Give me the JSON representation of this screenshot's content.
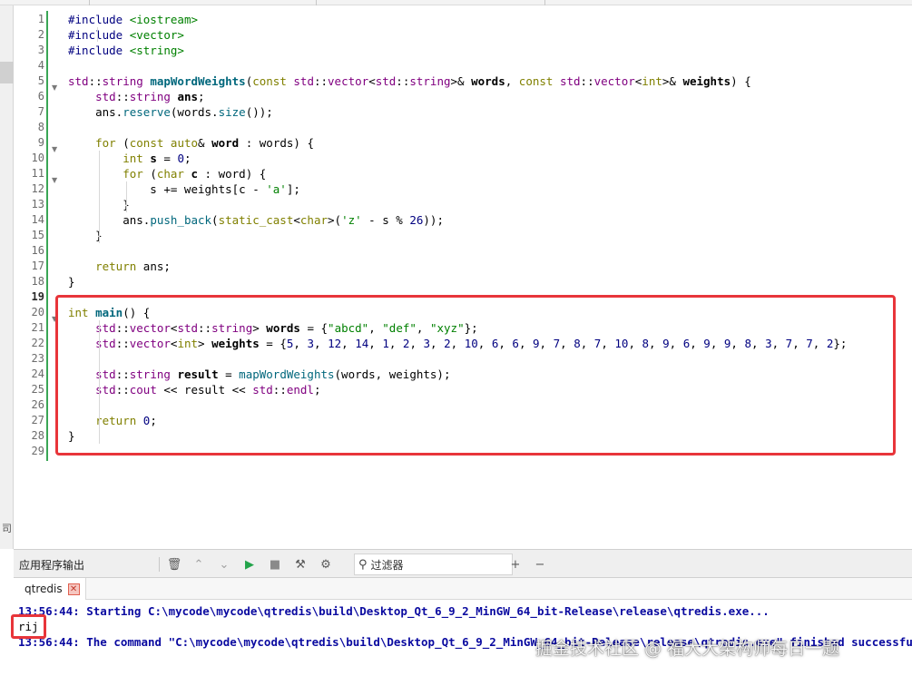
{
  "editor": {
    "line_numbers": [
      "1",
      "2",
      "3",
      "4",
      "5",
      "6",
      "7",
      "8",
      "9",
      "10",
      "11",
      "12",
      "13",
      "14",
      "15",
      "16",
      "17",
      "18",
      "19",
      "20",
      "21",
      "22",
      "23",
      "24",
      "25",
      "26",
      "27",
      "28",
      "29"
    ],
    "current_line": "19",
    "lines": [
      [
        {
          "t": "#include ",
          "c": "pp"
        },
        {
          "t": "<iostream>",
          "c": "inc"
        }
      ],
      [
        {
          "t": "#include ",
          "c": "pp"
        },
        {
          "t": "<vector>",
          "c": "inc"
        }
      ],
      [
        {
          "t": "#include ",
          "c": "pp"
        },
        {
          "t": "<string>",
          "c": "inc"
        }
      ],
      [],
      [
        {
          "t": "std",
          "c": "ty"
        },
        {
          "t": "::"
        },
        {
          "t": "string",
          "c": "ty"
        },
        {
          "t": " "
        },
        {
          "t": "mapWordWeights",
          "c": "fn bold"
        },
        {
          "t": "("
        },
        {
          "t": "const",
          "c": "kw"
        },
        {
          "t": " "
        },
        {
          "t": "std",
          "c": "ty"
        },
        {
          "t": "::"
        },
        {
          "t": "vector",
          "c": "ty"
        },
        {
          "t": "<"
        },
        {
          "t": "std",
          "c": "ty"
        },
        {
          "t": "::"
        },
        {
          "t": "string",
          "c": "ty"
        },
        {
          "t": ">& "
        },
        {
          "t": "words",
          "c": "bold"
        },
        {
          "t": ", "
        },
        {
          "t": "const",
          "c": "kw"
        },
        {
          "t": " "
        },
        {
          "t": "std",
          "c": "ty"
        },
        {
          "t": "::"
        },
        {
          "t": "vector",
          "c": "ty"
        },
        {
          "t": "<"
        },
        {
          "t": "int",
          "c": "kw"
        },
        {
          "t": ">& "
        },
        {
          "t": "weights",
          "c": "bold"
        },
        {
          "t": ") {"
        }
      ],
      [
        {
          "t": "    "
        },
        {
          "t": "std",
          "c": "ty"
        },
        {
          "t": "::"
        },
        {
          "t": "string",
          "c": "ty"
        },
        {
          "t": " "
        },
        {
          "t": "ans",
          "c": "bold"
        },
        {
          "t": ";"
        }
      ],
      [
        {
          "t": "    ans."
        },
        {
          "t": "reserve",
          "c": "fn"
        },
        {
          "t": "(words."
        },
        {
          "t": "size",
          "c": "fn"
        },
        {
          "t": "());"
        }
      ],
      [],
      [
        {
          "t": "    "
        },
        {
          "t": "for",
          "c": "kw"
        },
        {
          "t": " ("
        },
        {
          "t": "const",
          "c": "kw"
        },
        {
          "t": " "
        },
        {
          "t": "auto",
          "c": "kw"
        },
        {
          "t": "& "
        },
        {
          "t": "word",
          "c": "bold"
        },
        {
          "t": " : words) {"
        }
      ],
      [
        {
          "t": "        "
        },
        {
          "t": "int",
          "c": "kw"
        },
        {
          "t": " "
        },
        {
          "t": "s",
          "c": "bold"
        },
        {
          "t": " = "
        },
        {
          "t": "0",
          "c": "nm"
        },
        {
          "t": ";"
        }
      ],
      [
        {
          "t": "        "
        },
        {
          "t": "for",
          "c": "kw"
        },
        {
          "t": " ("
        },
        {
          "t": "char",
          "c": "kw"
        },
        {
          "t": " "
        },
        {
          "t": "c",
          "c": "bold"
        },
        {
          "t": " : word) {"
        }
      ],
      [
        {
          "t": "            s += weights[c - "
        },
        {
          "t": "'a'",
          "c": "st"
        },
        {
          "t": "];"
        }
      ],
      [
        {
          "t": "        }"
        }
      ],
      [
        {
          "t": "        ans."
        },
        {
          "t": "push_back",
          "c": "fn"
        },
        {
          "t": "("
        },
        {
          "t": "static_cast",
          "c": "kw"
        },
        {
          "t": "<"
        },
        {
          "t": "char",
          "c": "kw"
        },
        {
          "t": ">("
        },
        {
          "t": "'z'",
          "c": "st"
        },
        {
          "t": " - s % "
        },
        {
          "t": "26",
          "c": "nm"
        },
        {
          "t": "));"
        }
      ],
      [
        {
          "t": "    }"
        }
      ],
      [],
      [
        {
          "t": "    "
        },
        {
          "t": "return",
          "c": "kw"
        },
        {
          "t": " ans;"
        }
      ],
      [
        {
          "t": "}"
        }
      ],
      [],
      [
        {
          "t": "int",
          "c": "kw"
        },
        {
          "t": " "
        },
        {
          "t": "main",
          "c": "fn bold"
        },
        {
          "t": "() {"
        }
      ],
      [
        {
          "t": "    "
        },
        {
          "t": "std",
          "c": "ty"
        },
        {
          "t": "::"
        },
        {
          "t": "vector",
          "c": "ty"
        },
        {
          "t": "<"
        },
        {
          "t": "std",
          "c": "ty"
        },
        {
          "t": "::"
        },
        {
          "t": "string",
          "c": "ty"
        },
        {
          "t": "> "
        },
        {
          "t": "words",
          "c": "bold"
        },
        {
          "t": " = {"
        },
        {
          "t": "\"abcd\"",
          "c": "st"
        },
        {
          "t": ", "
        },
        {
          "t": "\"def\"",
          "c": "st"
        },
        {
          "t": ", "
        },
        {
          "t": "\"xyz\"",
          "c": "st"
        },
        {
          "t": "};"
        }
      ],
      [
        {
          "t": "    "
        },
        {
          "t": "std",
          "c": "ty"
        },
        {
          "t": "::"
        },
        {
          "t": "vector",
          "c": "ty"
        },
        {
          "t": "<"
        },
        {
          "t": "int",
          "c": "kw"
        },
        {
          "t": "> "
        },
        {
          "t": "weights",
          "c": "bold"
        },
        {
          "t": " = {"
        },
        {
          "t": "5",
          "c": "nm"
        },
        {
          "t": ", "
        },
        {
          "t": "3",
          "c": "nm"
        },
        {
          "t": ", "
        },
        {
          "t": "12",
          "c": "nm"
        },
        {
          "t": ", "
        },
        {
          "t": "14",
          "c": "nm"
        },
        {
          "t": ", "
        },
        {
          "t": "1",
          "c": "nm"
        },
        {
          "t": ", "
        },
        {
          "t": "2",
          "c": "nm"
        },
        {
          "t": ", "
        },
        {
          "t": "3",
          "c": "nm"
        },
        {
          "t": ", "
        },
        {
          "t": "2",
          "c": "nm"
        },
        {
          "t": ", "
        },
        {
          "t": "10",
          "c": "nm"
        },
        {
          "t": ", "
        },
        {
          "t": "6",
          "c": "nm"
        },
        {
          "t": ", "
        },
        {
          "t": "6",
          "c": "nm"
        },
        {
          "t": ", "
        },
        {
          "t": "9",
          "c": "nm"
        },
        {
          "t": ", "
        },
        {
          "t": "7",
          "c": "nm"
        },
        {
          "t": ", "
        },
        {
          "t": "8",
          "c": "nm"
        },
        {
          "t": ", "
        },
        {
          "t": "7",
          "c": "nm"
        },
        {
          "t": ", "
        },
        {
          "t": "10",
          "c": "nm"
        },
        {
          "t": ", "
        },
        {
          "t": "8",
          "c": "nm"
        },
        {
          "t": ", "
        },
        {
          "t": "9",
          "c": "nm"
        },
        {
          "t": ", "
        },
        {
          "t": "6",
          "c": "nm"
        },
        {
          "t": ", "
        },
        {
          "t": "9",
          "c": "nm"
        },
        {
          "t": ", "
        },
        {
          "t": "9",
          "c": "nm"
        },
        {
          "t": ", "
        },
        {
          "t": "8",
          "c": "nm"
        },
        {
          "t": ", "
        },
        {
          "t": "3",
          "c": "nm"
        },
        {
          "t": ", "
        },
        {
          "t": "7",
          "c": "nm"
        },
        {
          "t": ", "
        },
        {
          "t": "7",
          "c": "nm"
        },
        {
          "t": ", "
        },
        {
          "t": "2",
          "c": "nm"
        },
        {
          "t": "};"
        }
      ],
      [],
      [
        {
          "t": "    "
        },
        {
          "t": "std",
          "c": "ty"
        },
        {
          "t": "::"
        },
        {
          "t": "string",
          "c": "ty"
        },
        {
          "t": " "
        },
        {
          "t": "result",
          "c": "bold"
        },
        {
          "t": " = "
        },
        {
          "t": "mapWordWeights",
          "c": "fn"
        },
        {
          "t": "(words, weights);"
        }
      ],
      [
        {
          "t": "    "
        },
        {
          "t": "std",
          "c": "ty"
        },
        {
          "t": "::"
        },
        {
          "t": "cout",
          "c": "ty"
        },
        {
          "t": " << result << "
        },
        {
          "t": "std",
          "c": "ty"
        },
        {
          "t": "::"
        },
        {
          "t": "endl",
          "c": "ty"
        },
        {
          "t": ";"
        }
      ],
      [],
      [
        {
          "t": "    "
        },
        {
          "t": "return",
          "c": "kw"
        },
        {
          "t": " "
        },
        {
          "t": "0",
          "c": "nm"
        },
        {
          "t": ";"
        }
      ],
      [
        {
          "t": "}"
        }
      ],
      []
    ]
  },
  "side_strip": {
    "glyph": "司"
  },
  "output_panel": {
    "title": "应用程序输出",
    "filter_label": "过滤器",
    "tab_label": "qtredis",
    "tab_close": "✕",
    "line1": "13:56:44: Starting C:\\mycode\\mycode\\qtredis\\build\\Desktop_Qt_6_9_2_MinGW_64_bit-Release\\release\\qtredis.exe...",
    "line2": "rij",
    "line3": "13:56:44: The command \"C:\\mycode\\mycode\\qtredis\\build\\Desktop_Qt_6_9_2_MinGW_64_bit-Release\\release\\qtredis.exe\" finished successfully."
  },
  "icons": {
    "clear": "🗑",
    "up": "⌃",
    "down": "⌄",
    "run": "▶",
    "stop": "■",
    "attach": "⚒",
    "settings": "⚙",
    "filter": "⚲",
    "add": "+",
    "remove": "−"
  },
  "watermark": "掘金技术社区 @ 福大大架构师每日一题"
}
